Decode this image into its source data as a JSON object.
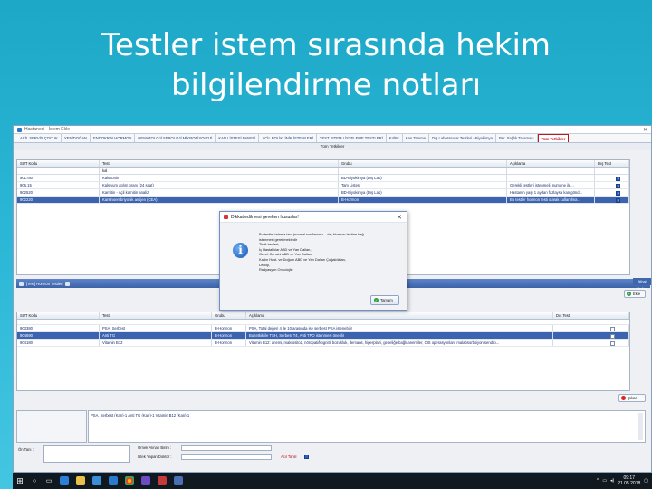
{
  "slide": {
    "title_line1": "Testler istem sırasında hekim",
    "title_line2": "bilgilendirme notları"
  },
  "window": {
    "title": "Hastanesi - İstem Ekle"
  },
  "menu": {
    "tabs": [
      "ACİL SERVİS ÇOCUK",
      "YENİDOĞAN",
      "ENDOKRİN HORMON",
      "HEMATOLOJİ SEROLOJİ MİKROBİYOLOJİ",
      "KAN LİSTESİ PANELİ",
      "ACİL POLİKLİNİK İSTEMLERİ",
      "TEST İSTEM LİSTELEME TESTLERİ",
      "Kültür",
      "Kan Tanıma",
      "Dış Laboratuvar Testleri - Biyokimya",
      "Per. Sağlık Taraması",
      "Tüm Tetkikler"
    ],
    "active_index": 11
  },
  "top_grid": {
    "subtitle": "Tüm Tetkikler",
    "headers": [
      "SUT Kodu",
      "Test",
      "Grubu",
      "Açıklama",
      "Dış Test"
    ],
    "filter": [
      "",
      "kal",
      "",
      "",
      ""
    ],
    "rows": [
      {
        "code": "901780",
        "test": "Kalsitonin",
        "group": "BD-Biyokimya (Dış Lab)",
        "note": "",
        "checked": true
      },
      {
        "code": "906.15",
        "test": "Kalsiyum atılım oranı (24 saat)",
        "group": "Tam Listesi",
        "note": "Gerekli testleri istenmeli, numune ile...",
        "checked": true
      },
      {
        "code": "902520",
        "test": "Karnitin - Açil karnitin analizi",
        "group": "BD-Biyokimya (Dış Lab)",
        "note": "Hastanın yaşı 1 aydan fazlaysa kan gönd...",
        "checked": true
      },
      {
        "code": "902220",
        "test": "Karsinoembriyonik antijen (CEA)",
        "group": "B-Hormon",
        "note": "Bu testler hormon testi olarak kullanılma...",
        "checked": true,
        "selected": true
      }
    ]
  },
  "selected_bar": {
    "label": "[Test] Hormon Testleri"
  },
  "right_strip_label": "Nihai Değer",
  "add_button": "Ekle",
  "bottom_grid": {
    "headers": [
      "SUT Kodu",
      "Testi",
      "Grubu",
      "Açıklama",
      "Dış Test"
    ],
    "rows": [
      {
        "code": "903380",
        "test": "PSA, Serbest",
        "group": "B-Hormon",
        "note": "PSA, Total değeri 4 ile 10 arasında ise serbest PSA istenebilir",
        "checked": false
      },
      {
        "code": "904690",
        "test": "Anti TG",
        "group": "B-Hormon",
        "note": "Bu tetkik ile TSH, Serbest T4, Anti TPO istenmesi önerilir",
        "checked": false,
        "selected": true
      },
      {
        "code": "904180",
        "test": "Vitamin B12",
        "group": "B-Hormon",
        "note": "Vitamin B12: anemi, makrositoz, nöropati/kognitif bozukluk, demans, hiperplazi, gebeliğe bağlı anemiler, CIS operasyonları, malabsorbsiyon sendro...",
        "checked": false
      }
    ]
  },
  "delete_button": "Çıkar",
  "notes_text": "PSA, Serbest (Kan)-1 Anti TG (Kan)-1 Vitamin B12 (Kan)-1",
  "bottom_form": {
    "note_label": "Ön Tanı :",
    "sample_label": "Örnek Alınan Birim :",
    "doctor_label": "İstek Yapan Doktor :",
    "emergency_label": "Acil Tahlil"
  },
  "dialog": {
    "title": "Dikkat edilmesi gereken hususlar!",
    "lines": [
      "Bu testler talama tanı (normal sınıflaması... da; Hormon testine bağ",
      "istenmesi gerekmektedir",
      "      Tiroit bezleri;",
      "   İç Hastalıklar ABD ve Yan Dalları,",
      "   Genel Cerrahi ABD ve Yan Dalları,",
      "   Kadın Hast. ve Doğum ABD ve Yan Dalları Çoğaldıkları,",
      "   Üroloji,",
      "   Radyasyon Onkolojisi"
    ],
    "ok_label": "Tamam"
  },
  "taskbar": {
    "time": "09:17",
    "date": "21.05.2018"
  }
}
